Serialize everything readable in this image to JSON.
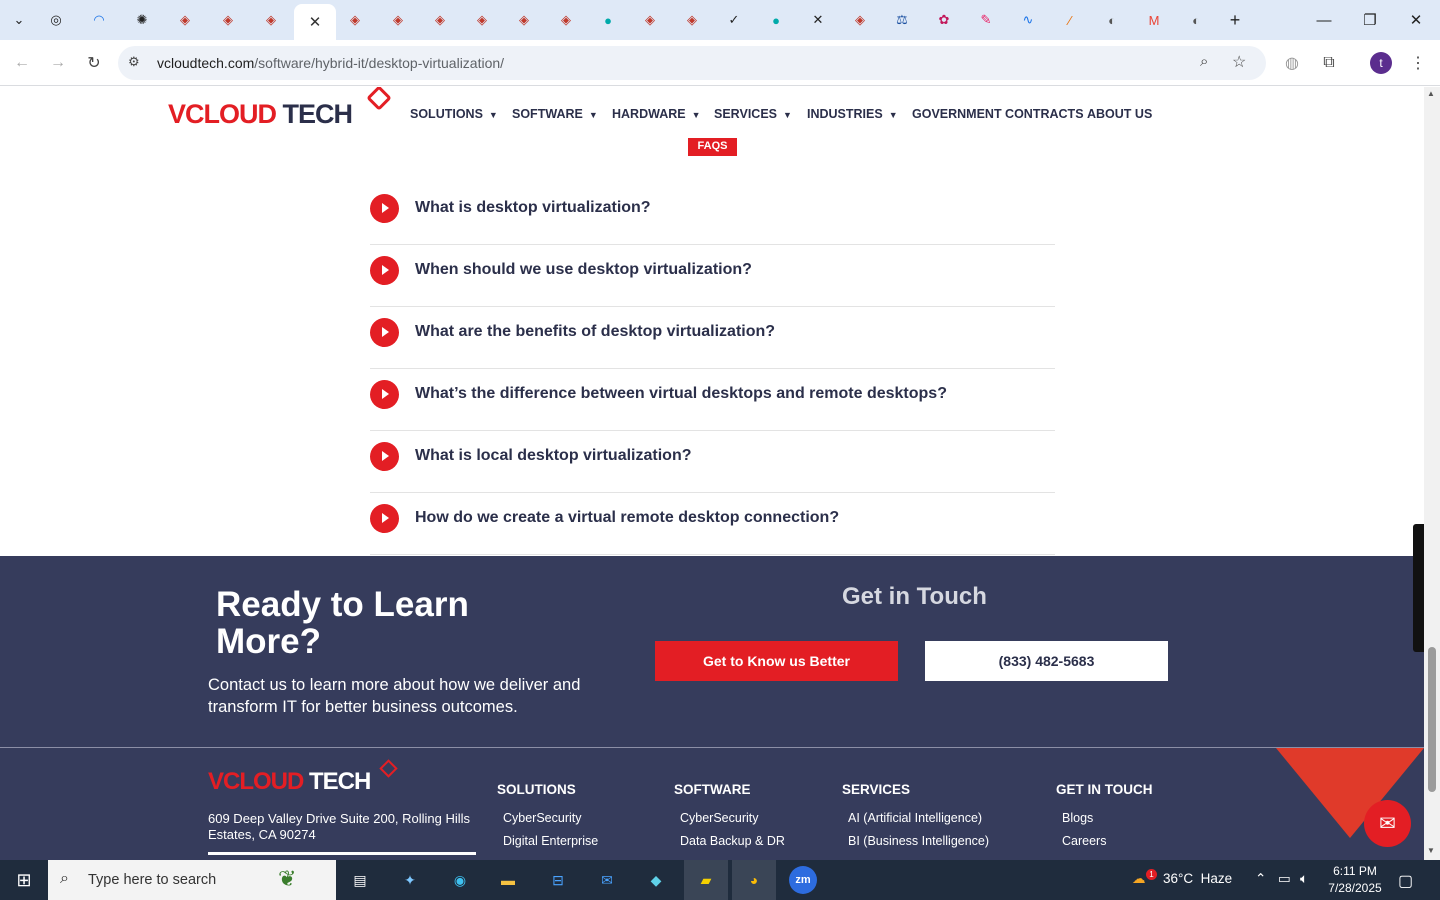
{
  "browser": {
    "url_host": "vcloudtech.com",
    "url_path": "/software/hybrid-it/desktop-virtualization/",
    "profile_initial": "t"
  },
  "site": {
    "logo_part1": "V",
    "logo_part2": "CLOUD",
    "logo_part3": " TECH",
    "nav": [
      {
        "label": "SOLUTIONS",
        "caret": "▼"
      },
      {
        "label": "SOFTWARE",
        "caret": "▼"
      },
      {
        "label": "HARDWARE",
        "caret": "▼"
      },
      {
        "label": "SERVICES",
        "caret": "▼"
      },
      {
        "label": "INDUSTRIES",
        "caret": "▼"
      },
      {
        "label": "GOVERNMENT CONTRACTS",
        "caret": ""
      },
      {
        "label": "ABOUT US",
        "caret": ""
      }
    ],
    "faqs_tag": "FAQS"
  },
  "faqs": [
    "What is desktop virtualization?",
    "When should we use desktop virtualization?",
    "What are the benefits of desktop virtualization?",
    "What’s the difference between virtual desktops and remote desktops?",
    "What is local desktop virtualization?",
    "How do we create a virtual remote desktop connection?"
  ],
  "cta": {
    "title": "Ready to Learn More?",
    "text": "Contact us to learn more about how we deliver and transform IT for better business outcomes.",
    "get_in_touch": "Get in Touch",
    "know_button": "Get to Know us Better",
    "phone_button": "(833) 482-5683"
  },
  "footer": {
    "address": "609 Deep Valley Drive Suite 200, Rolling Hills Estates, CA 90274",
    "columns": [
      {
        "heading": "SOLUTIONS",
        "links": [
          "CyberSecurity",
          "Digital Enterprise"
        ]
      },
      {
        "heading": "SOFTWARE",
        "links": [
          "CyberSecurity",
          "Data Backup & DR"
        ]
      },
      {
        "heading": "SERVICES",
        "links": [
          "AI (Artificial Intelligence)",
          "BI (Business Intelligence)"
        ]
      },
      {
        "heading": "GET IN TOUCH",
        "links": [
          "Blogs",
          "Careers"
        ]
      }
    ]
  },
  "taskbar": {
    "search_placeholder": "Type here to search",
    "weather": "36°C  Haze",
    "weather_badge": "1",
    "time": "6:11 PM",
    "date": "7/28/2025"
  },
  "colors": {
    "brand_red": "#e31e24",
    "brand_navy": "#363c5c",
    "text_navy": "#2b2f4a"
  }
}
